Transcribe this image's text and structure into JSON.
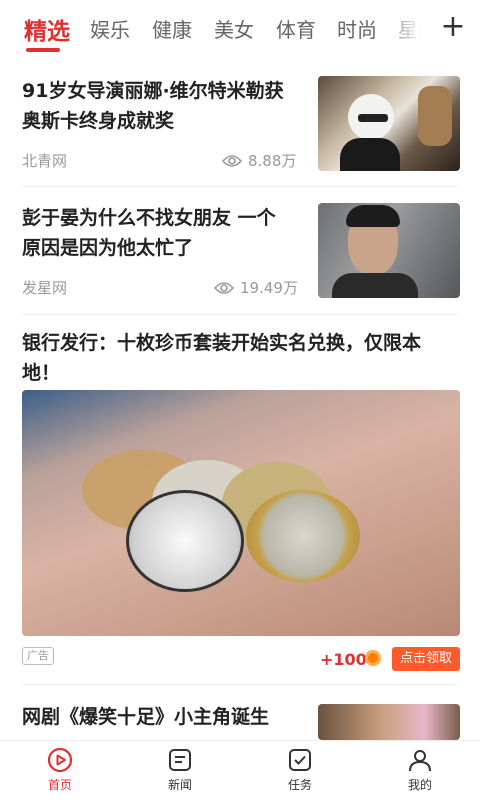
{
  "tabs": [
    "精选",
    "娱乐",
    "健康",
    "美女",
    "体育",
    "时尚",
    "星座"
  ],
  "articles": [
    {
      "title_line1": "91岁女导演丽娜·维尔特米勒获",
      "title_line2": "奥斯卡终身成就奖",
      "source": "北青网",
      "views": "8.88万"
    },
    {
      "title_line1": "彭于晏为什么不找女朋友 一个",
      "title_line2": "原因是因为他太忙了",
      "source": "发星网",
      "views": "19.49万"
    }
  ],
  "ad": {
    "title_line1": "银行发行：十枚珍币套装开始实名兑换，仅限本",
    "title_line2": "地！",
    "tag": "广告",
    "points": "+100",
    "cta": "点击领取"
  },
  "article4": {
    "title": "网剧《爆笑十足》小主角诞生"
  },
  "bottom_nav": [
    {
      "label": "首页",
      "icon": "play-circle-icon"
    },
    {
      "label": "新闻",
      "icon": "news-icon"
    },
    {
      "label": "任务",
      "icon": "task-check-icon"
    },
    {
      "label": "我的",
      "icon": "user-icon"
    }
  ],
  "colors": {
    "accent": "#e03030",
    "cta": "#ff5a2a",
    "muted": "#999999"
  }
}
